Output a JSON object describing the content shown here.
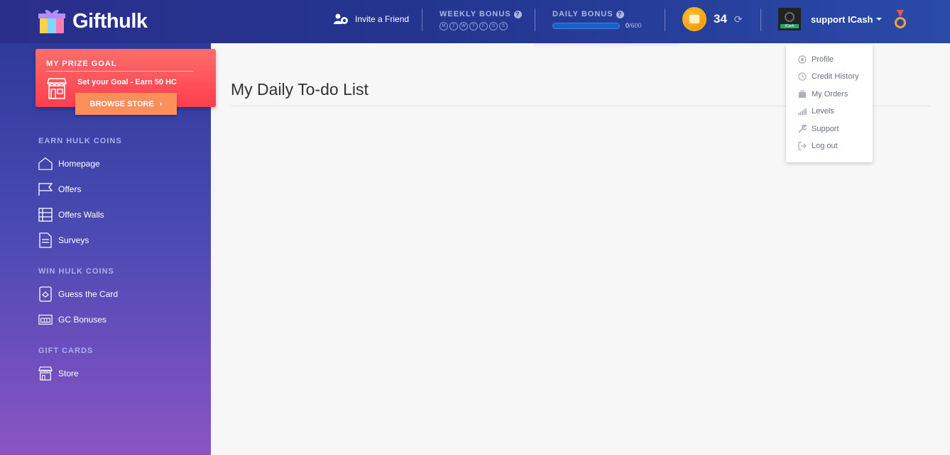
{
  "brand": {
    "name": "Gifthulk"
  },
  "header": {
    "invite_label": "Invite a Friend",
    "weekly_bonus": {
      "label": "WEEKLY BONUS",
      "days": [
        "M",
        "T",
        "W",
        "T",
        "F",
        "S",
        "S"
      ]
    },
    "daily_bonus": {
      "label": "DAILY BONUS",
      "progress_current": "0",
      "progress_total": "/600",
      "progress_fraction": 0
    },
    "coins": "34",
    "username": "support ICash",
    "avatar_label": "ICash"
  },
  "prize_goal": {
    "title": "MY PRIZE GOAL",
    "subtitle": "Set your Goal - Earn 50 HC",
    "button_label": "BROWSE STORE"
  },
  "sidebar": {
    "sections": [
      {
        "title": "EARN HULK COINS",
        "items": [
          {
            "label": "Homepage",
            "icon": "home-icon"
          },
          {
            "label": "Offers",
            "icon": "flag-icon"
          },
          {
            "label": "Offers Walls",
            "icon": "list-icon"
          },
          {
            "label": "Surveys",
            "icon": "document-icon"
          }
        ]
      },
      {
        "title": "WIN HULK COINS",
        "items": [
          {
            "label": "Guess the Card",
            "icon": "card-icon"
          },
          {
            "label": "GC Bonuses",
            "icon": "ticket-icon"
          }
        ]
      },
      {
        "title": "GIFT CARDS",
        "items": [
          {
            "label": "Store",
            "icon": "store-icon"
          }
        ]
      }
    ]
  },
  "main": {
    "title": "My Daily To-do List"
  },
  "dropdown": {
    "items": [
      {
        "label": "Profile",
        "icon": "target-icon"
      },
      {
        "label": "Credit History",
        "icon": "clock-icon"
      },
      {
        "label": "My Orders",
        "icon": "briefcase-icon"
      },
      {
        "label": "Levels",
        "icon": "signal-icon"
      },
      {
        "label": "Support",
        "icon": "wrench-icon"
      },
      {
        "label": "Log out",
        "icon": "logout-icon"
      }
    ]
  },
  "colors": {
    "header": "#23358f",
    "prize": "#ff4d5a",
    "browse_button": "#ff8f5a",
    "sidebar_top": "#2f3a9a",
    "sidebar_bottom": "#8a55c2"
  }
}
